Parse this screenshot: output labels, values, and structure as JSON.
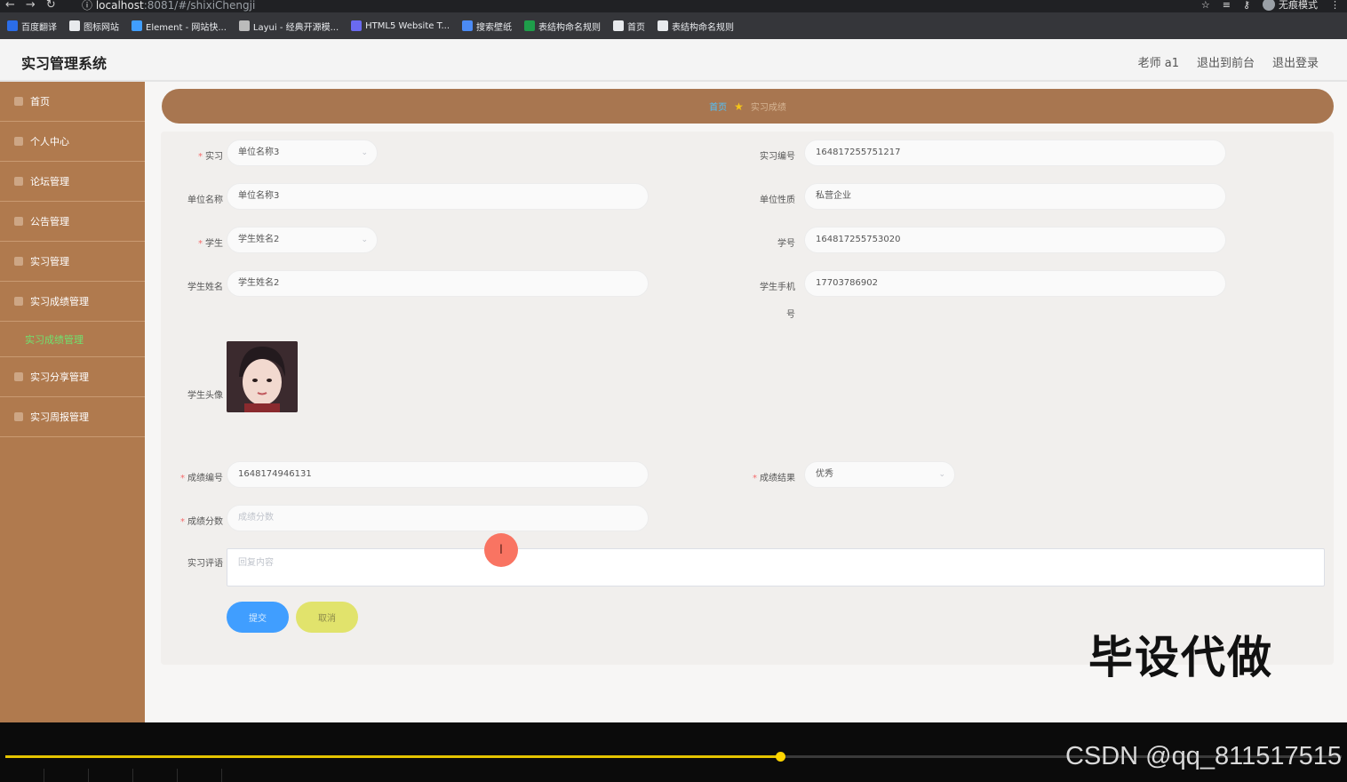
{
  "browser": {
    "url_host": "localhost",
    "url_path": ":8081/#/shixiChengji",
    "incognito_label": "无痕模式",
    "bookmarks": [
      {
        "label": "百度翻译",
        "icon": "translate-icon",
        "color": "#2b6de8"
      },
      {
        "label": "图标网站",
        "icon": "folder-icon",
        "color": "#e8eaed"
      },
      {
        "label": "Element - 网站快...",
        "icon": "element-icon",
        "color": "#409eff"
      },
      {
        "label": "Layui - 经典开源模...",
        "icon": "layui-icon",
        "color": "#bbbbbb"
      },
      {
        "label": "HTML5 Website T...",
        "icon": "html5-icon",
        "color": "#6a6af0"
      },
      {
        "label": "搜索壁纸",
        "icon": "wallpaper-icon",
        "color": "#4b8bf5"
      },
      {
        "label": "表结构命名规则",
        "icon": "sheet-icon",
        "color": "#1e9e4a"
      },
      {
        "label": "首页",
        "icon": "globe-icon",
        "color": "#e8eaed"
      },
      {
        "label": "表结构命名规则",
        "icon": "globe-icon",
        "color": "#e8eaed"
      }
    ]
  },
  "header": {
    "title": "实习管理系统",
    "user": "老师 a1",
    "back_to_front": "退出到前台",
    "logout": "退出登录"
  },
  "sidebar": {
    "items": [
      {
        "label": "首页",
        "icon": "home-icon"
      },
      {
        "label": "个人中心",
        "icon": "user-icon"
      },
      {
        "label": "论坛管理",
        "icon": "forum-icon"
      },
      {
        "label": "公告管理",
        "icon": "notice-icon"
      },
      {
        "label": "实习管理",
        "icon": "internship-icon"
      },
      {
        "label": "实习成绩管理",
        "icon": "score-icon"
      },
      {
        "label": "实习分享管理",
        "icon": "share-icon"
      },
      {
        "label": "实习周报管理",
        "icon": "report-icon"
      }
    ],
    "sub_item": "实习成绩管理"
  },
  "breadcrumb": {
    "home": "首页",
    "current": "实习成绩"
  },
  "form": {
    "internship_label": "实习",
    "internship_value": "单位名称3",
    "internship_no_label": "实习编号",
    "internship_no_value": "164817255751217",
    "company_name_label": "单位名称",
    "company_name_value": "单位名称3",
    "company_type_label": "单位性质",
    "company_type_value": "私营企业",
    "student_label": "学生",
    "student_value": "学生姓名2",
    "student_no_label": "学号",
    "student_no_value": "164817255753020",
    "student_name_label": "学生姓名",
    "student_name_value": "学生姓名2",
    "student_phone_label": "学生手机",
    "student_phone_label_wrap": "号",
    "student_phone_value": "17703786902",
    "avatar_label": "学生头像",
    "score_no_label": "成绩编号",
    "score_no_value": "1648174946131",
    "score_result_label": "成绩结果",
    "score_result_value": "优秀",
    "score_label": "成绩分数",
    "score_placeholder": "成绩分数",
    "comment_label": "实习评语",
    "comment_placeholder": "回复内容",
    "submit": "提交",
    "cancel": "取消"
  },
  "overlay": {
    "watermark": "毕设代做",
    "cursor_glyph": "I",
    "csdn": "CSDN @qq_811517515"
  },
  "player": {
    "progress": 0.58
  },
  "colors": {
    "sidebar": "#b07a4e",
    "breadcrumb": "#a87650",
    "submit": "#409eff",
    "cancel": "#e1e36c",
    "progress": "#e5c400"
  }
}
